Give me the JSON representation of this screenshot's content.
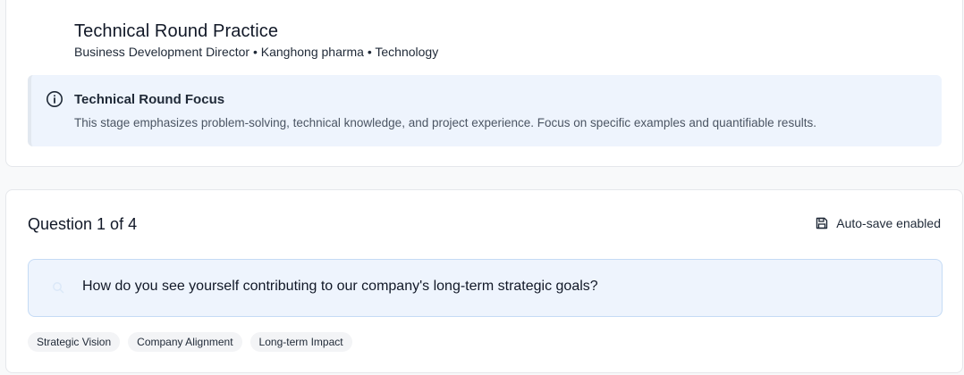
{
  "practice": {
    "title": "Technical Round Practice",
    "subtitle": "Business Development Director • Kanghong pharma • Technology"
  },
  "focus": {
    "title": "Technical Round Focus",
    "text": "This stage emphasizes problem-solving, technical knowledge, and project experience. Focus on specific examples and quantifiable results."
  },
  "question_card": {
    "header": "Question 1 of 4",
    "autosave_label": "Auto-save enabled",
    "question": "How do you see yourself contributing to our company's long-term strategic goals?",
    "tags": [
      "Strategic Vision",
      "Company Alignment",
      "Long-term Impact"
    ]
  },
  "colors": {
    "callout_bg": "#eef4fd",
    "question_border": "#c5dbf5",
    "tag_bg": "#f3f4f6"
  },
  "icons": {
    "focus": "info-icon",
    "autosave": "save-icon",
    "question": "search-icon"
  }
}
